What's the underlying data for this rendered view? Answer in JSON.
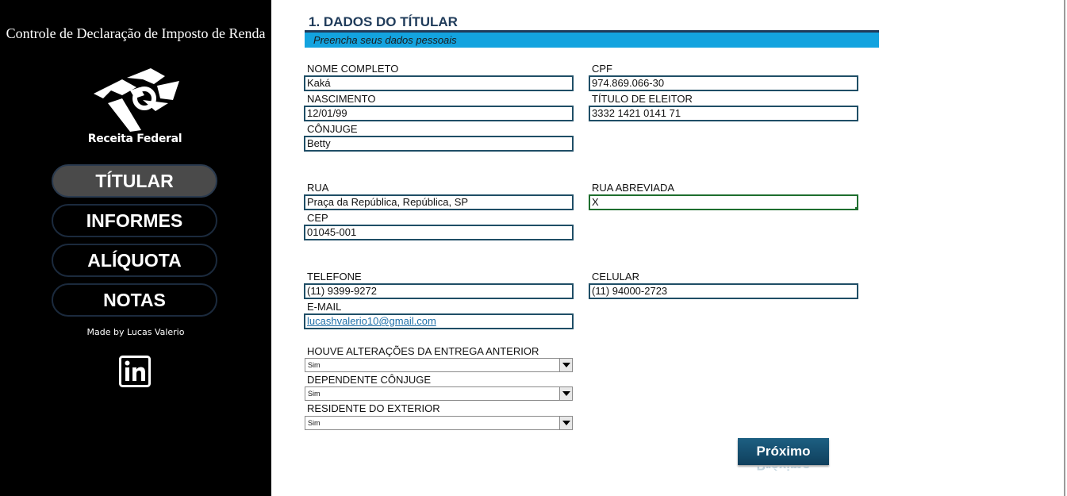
{
  "sidebar": {
    "app_title": "Controle de Declaração de Imposto de Renda",
    "logo_text": "Receita Federal",
    "nav": [
      {
        "label": "TÍTULAR",
        "active": true
      },
      {
        "label": "INFORMES",
        "active": false
      },
      {
        "label": "ALÍQUOTA",
        "active": false
      },
      {
        "label": "NOTAS",
        "active": false
      }
    ],
    "made_by": "Made by Lucas Valerio",
    "linkedin_icon": "linkedin-icon"
  },
  "form": {
    "section_title": "1. DADOS DO TÍTULAR",
    "subtitle": "Preencha seus dados pessoais",
    "nome_label": "NOME COMPLETO",
    "nome_value": "Kaká",
    "cpf_label": "CPF",
    "cpf_value": "974.869.066-30",
    "nascimento_label": "NASCIMENTO",
    "nascimento_value": "12/01/99",
    "titulo_label": "TÍTULO DE ELEITOR",
    "titulo_value": "3332 1421 0141 71",
    "conjuge_label": "CÔNJUGE",
    "conjuge_value": "Betty",
    "rua_label": "RUA",
    "rua_value": "Praça da República, República, SP",
    "rua_abrev_label": "RUA ABREVIADA",
    "rua_abrev_value": "X",
    "cep_label": "CEP",
    "cep_value": "01045-001",
    "telefone_label": "TELEFONE",
    "telefone_value": "(11) 9399-9272",
    "celular_label": "CELULAR",
    "celular_value": "(11) 94000-2723",
    "email_label": "E-MAIL",
    "email_value": "lucashvalerio10@gmail.com",
    "alteracoes_label": "HOUVE ALTERAÇÕES DA ENTREGA ANTERIOR",
    "alteracoes_value": "Sim",
    "dependente_label": "DEPENDENTE CÔNJUGE",
    "dependente_value": "Sim",
    "residente_label": "RESIDENTE DO EXTERIOR",
    "residente_value": "Sim",
    "next_button": "Próximo"
  },
  "colors": {
    "sidebar_bg": "#000000",
    "accent_blue": "#13a3df",
    "title_navy": "#1f3b5a",
    "button_teal": "#1d5f82"
  }
}
